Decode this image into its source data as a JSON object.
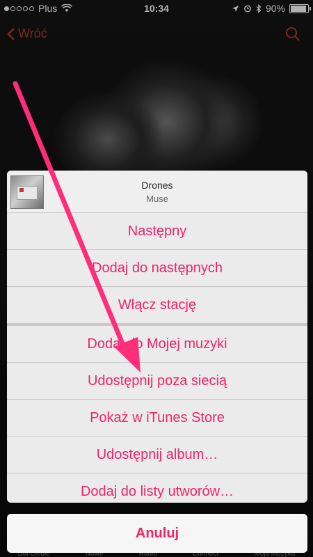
{
  "status_bar": {
    "carrier": "Plus",
    "time": "10:34",
    "battery": "90%",
    "battery_fraction": 0.9
  },
  "nav": {
    "back_label": "Wróć",
    "search_icon": "search-icon"
  },
  "action_sheet": {
    "song_title": "Drones",
    "artist": "Muse",
    "items": [
      "Następny",
      "Dodaj do następnych",
      "Włącz stację",
      "Dodaj do Mojej muzyki",
      "Udostępnij poza siecią",
      "Pokaż w iTunes Store",
      "Udostępnij album…",
      "Dodaj do listy utworów…"
    ],
    "cancel_label": "Anuluj"
  },
  "tab_bar": {
    "items": [
      "Dla Ciebie",
      "Nowe",
      "Radio",
      "Connect",
      "Moja muzyka"
    ]
  },
  "colors": {
    "accent": "#f0236b",
    "arrow": "#ff2d7a"
  }
}
